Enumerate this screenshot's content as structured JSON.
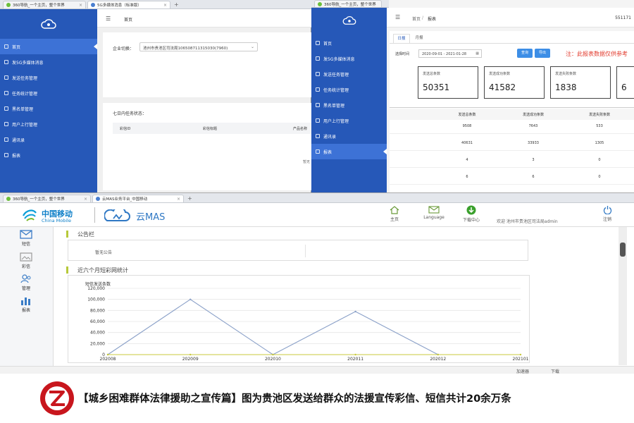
{
  "win1": {
    "tabs": [
      {
        "label": "360导航_一个主页，整个世界"
      },
      {
        "label": "5G多媒体消息（标准版）"
      }
    ],
    "breadcrumb": "首页",
    "nav": [
      "首页",
      "发5G多媒体消息",
      "发送任务管理",
      "任务统计管理",
      "黑名单管理",
      "用户上行管理",
      "通讯录",
      "报表"
    ],
    "enterprise_label": "企业切换：",
    "enterprise_value": "池州市贵池区司法局106508711315030(7960)",
    "tasks_title": "七日内任务状态：",
    "columns": [
      "彩信ID",
      "彩信标题",
      "产品名称"
    ],
    "side_note": "暂无"
  },
  "win2": {
    "breadcrumb_home": "首页",
    "breadcrumb_sep": "/",
    "breadcrumb_current": "报表",
    "top_right": "551171",
    "nav": [
      "首页",
      "发5G多媒体消息",
      "发送任务管理",
      "任务统计管理",
      "黑名单管理",
      "用户上行管理",
      "通讯录",
      "报表"
    ],
    "tabs": [
      "日报",
      "月报"
    ],
    "time_label": "选择时间",
    "date_range": "2020-09-01 - 2021-01-28",
    "query_btn": "查询",
    "export_btn": "导出",
    "notice": "注：此报表数据仅供参考",
    "cards": [
      {
        "label": "发送总条数",
        "value": "50351"
      },
      {
        "label": "发送成功条数",
        "value": "41582"
      },
      {
        "label": "发送失败条数",
        "value": "1838"
      },
      {
        "label": "",
        "value": "6"
      }
    ],
    "table_headers": [
      "发送总条数",
      "发送成功条数",
      "发送失败条数"
    ],
    "rows": [
      [
        "9508",
        "7643",
        "533"
      ],
      [
        "40631",
        "33933",
        "1305"
      ],
      [
        "4",
        "3",
        "0"
      ],
      [
        "6",
        "6",
        "0"
      ]
    ]
  },
  "win3": {
    "tabs": [
      {
        "label": "360导航_一个主页，整个世界"
      },
      {
        "label": "云MAS业务平台_中国移动"
      }
    ],
    "brand_cn": "中国移动",
    "brand_en": "China Mobile",
    "product": "云MAS",
    "toolbar": [
      {
        "label": "主页",
        "icon": "home-icon"
      },
      {
        "label": "Language",
        "icon": "mail-icon"
      },
      {
        "label": "下载中心",
        "icon": "download-icon"
      }
    ],
    "welcome": "欢迎 池州市贵池区司法局admin",
    "logout": "注销",
    "left_menu": [
      "短信",
      "彩信",
      "管理",
      "报表"
    ],
    "notice_title": "公告栏",
    "notice_text": "暂无公告",
    "stats_title": "近六个月短彩网统计",
    "status_text": "加速器",
    "status_extra": "下载"
  },
  "chart_data": {
    "type": "line",
    "ylabel": "短信发送条数",
    "categories": [
      "202008",
      "202009",
      "202010",
      "202011",
      "202012",
      "202101"
    ],
    "series": [
      {
        "values": [
          0,
          100000,
          0,
          78000,
          0,
          null
        ]
      },
      {
        "values": [
          0,
          0,
          0,
          0,
          0,
          0
        ]
      }
    ],
    "yticks": [
      "0",
      "20,000",
      "40,000",
      "60,000",
      "80,000",
      "100,000",
      "120,000"
    ],
    "ylim": [
      0,
      120000
    ],
    "colors": [
      "#8aa0c8",
      "#c8c83c"
    ]
  },
  "caption": {
    "text": "【城乡困难群体法律援助之宣传篇】图为贵池区发送给群众的法援宣传彩信、短信共计20余万条",
    "logo_color": "#c8161d"
  }
}
